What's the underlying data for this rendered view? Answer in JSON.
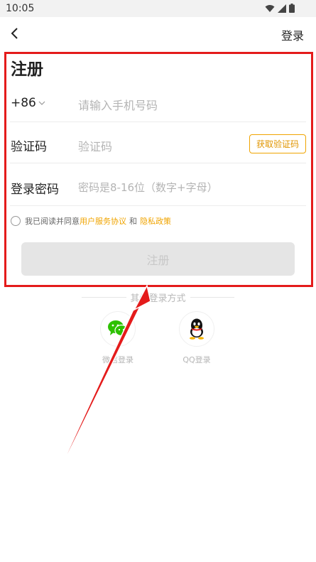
{
  "status_bar": {
    "time": "10:05"
  },
  "nav": {
    "login_label": "登录"
  },
  "form": {
    "title": "注册",
    "phone": {
      "country_code": "+86",
      "placeholder": "请输入手机号码"
    },
    "code": {
      "label": "验证码",
      "placeholder": "验证码",
      "button": "获取验证码"
    },
    "password": {
      "label": "登录密码",
      "placeholder": "密码是8-16位（数字+字母）"
    },
    "agreement": {
      "prefix": "我已阅读并同意",
      "terms": "用户服务协议",
      "and": "和",
      "privacy": "隐私政策"
    },
    "submit": "注册"
  },
  "other_login": {
    "title": "其他登录方式",
    "wechat": "微信登录",
    "qq": "QQ登录"
  },
  "colors": {
    "accent": "#f0a400",
    "annotation_red": "#e41b1b",
    "wechat_green": "#2dc100"
  },
  "icons": [
    "back-arrow-icon",
    "wifi-icon",
    "signal-icon",
    "battery-icon",
    "chevron-down-icon",
    "wechat-icon",
    "qq-icon"
  ]
}
